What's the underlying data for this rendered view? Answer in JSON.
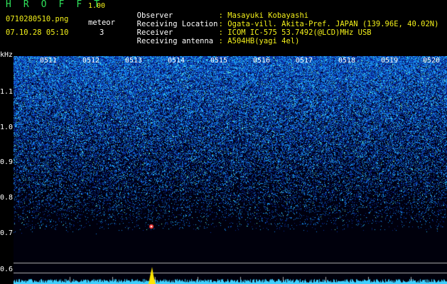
{
  "header": {
    "title": "H R O F F T",
    "version": "1.00",
    "filename": "0710280510.png",
    "datetime": "07.10.28 05:10",
    "meteor_label": "meteor",
    "meteor_count": "3"
  },
  "meta": {
    "observer_label": "Observer",
    "observer_value": ": Masayuki Kobayashi",
    "location_label": "Receiving Location",
    "location_value": ": Ogata-vill. Akita-Pref. JAPAN (139.96E, 40.02N)",
    "receiver_label": "Receiver",
    "receiver_value": ": ICOM IC-575 53.7492(@LCD)MHz USB",
    "antenna_label": "Receiving antenna",
    "antenna_value": ": A504HB(yagi 4el)"
  },
  "axis": {
    "unit": "kHz",
    "freq_ticks": [
      "1.1",
      "1.0",
      "0.9",
      "0.8",
      "0.7",
      "0.6"
    ],
    "time_ticks": [
      "0511",
      "0512",
      "0513",
      "0514",
      "0515",
      "0516",
      "0517",
      "0518",
      "0519",
      "0520"
    ]
  },
  "colors": {
    "title": "#2fe25a",
    "values": "#f3f01a",
    "noise_low": "#0a1a8a",
    "noise_high": "#35e0ff",
    "meteor": "#ffe600"
  }
}
